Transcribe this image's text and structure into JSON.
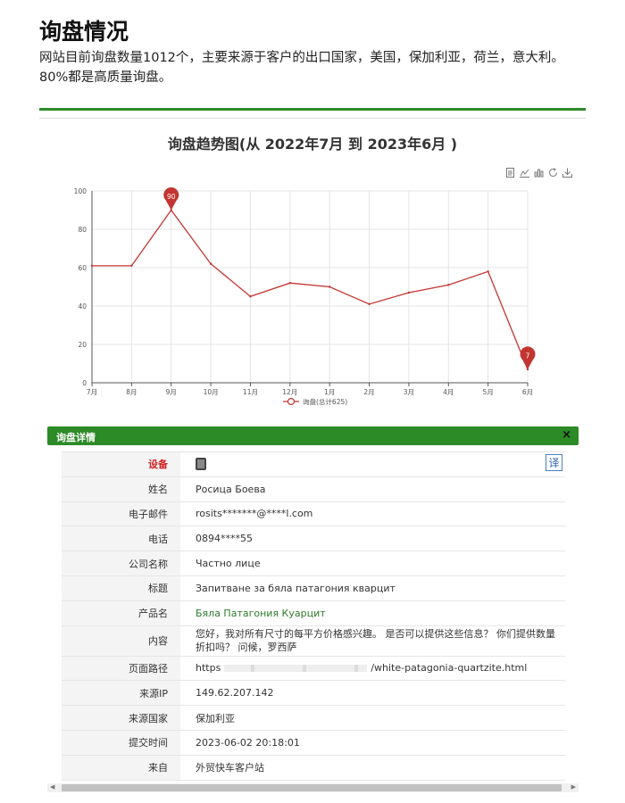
{
  "header": {
    "title": "询盘情况",
    "intro": "网站目前询盘数量1012个，主要来源于客户的出口国家，美国，保加利亚，荷兰，意大利。80%都是高质量询盘。"
  },
  "chart_data": {
    "type": "line",
    "title": "询盘趋势图(从 2022年7月 到 2023年6月 )",
    "categories": [
      "7月",
      "8月",
      "9月",
      "10月",
      "11月",
      "12月",
      "1月",
      "2月",
      "3月",
      "4月",
      "5月",
      "6月"
    ],
    "series": [
      {
        "name": "询盘(总计625)",
        "values": [
          61,
          61,
          90,
          62,
          45,
          52,
          50,
          41,
          47,
          51,
          58,
          7
        ]
      }
    ],
    "markers": [
      {
        "label": "90",
        "category": "9月",
        "value": 90
      },
      {
        "label": "7",
        "category": "6月",
        "value": 7
      }
    ],
    "ylim": [
      0,
      100
    ],
    "yticks": [
      0,
      20,
      40,
      60,
      80,
      100
    ],
    "grid": true,
    "legend": "bottom-center",
    "line_color": "#c23531"
  },
  "toolbox": [
    "data-view-icon",
    "line-switch-icon",
    "bar-switch-icon",
    "refresh-icon",
    "download-icon"
  ],
  "panel": {
    "title": "询盘详情",
    "close": "×",
    "translate": "译",
    "header_color": "#2c8a27",
    "fields": [
      {
        "label": "设备",
        "value": ""
      },
      {
        "label": "姓名",
        "value": "Росица Боева"
      },
      {
        "label": "电子邮件",
        "value": "rosits*******@****l.com"
      },
      {
        "label": "电话",
        "value": "0894****55"
      },
      {
        "label": "公司名称",
        "value": "Частно лице"
      },
      {
        "label": "标题",
        "value": "Запитване за бяла патагония кварцит"
      },
      {
        "label": "产品名",
        "value": "Бяла Патагония Куарцит"
      },
      {
        "label": "内容",
        "value": "您好，我对所有尺寸的每平方价格感兴趣。 是否可以提供这些信息？ 你们提供数量折扣吗？ 问候，罗西萨"
      },
      {
        "label": "页面路径",
        "value_prefix": "https",
        "value_suffix": "/white-patagonia-quartzite.html"
      },
      {
        "label": "来源IP",
        "value": "149.62.207.142"
      },
      {
        "label": "来源国家",
        "value": "保加利亚"
      },
      {
        "label": "提交时间",
        "value": "2023-06-02 20:18:01"
      },
      {
        "label": "来自",
        "value": "外贸快车客户站"
      }
    ]
  }
}
